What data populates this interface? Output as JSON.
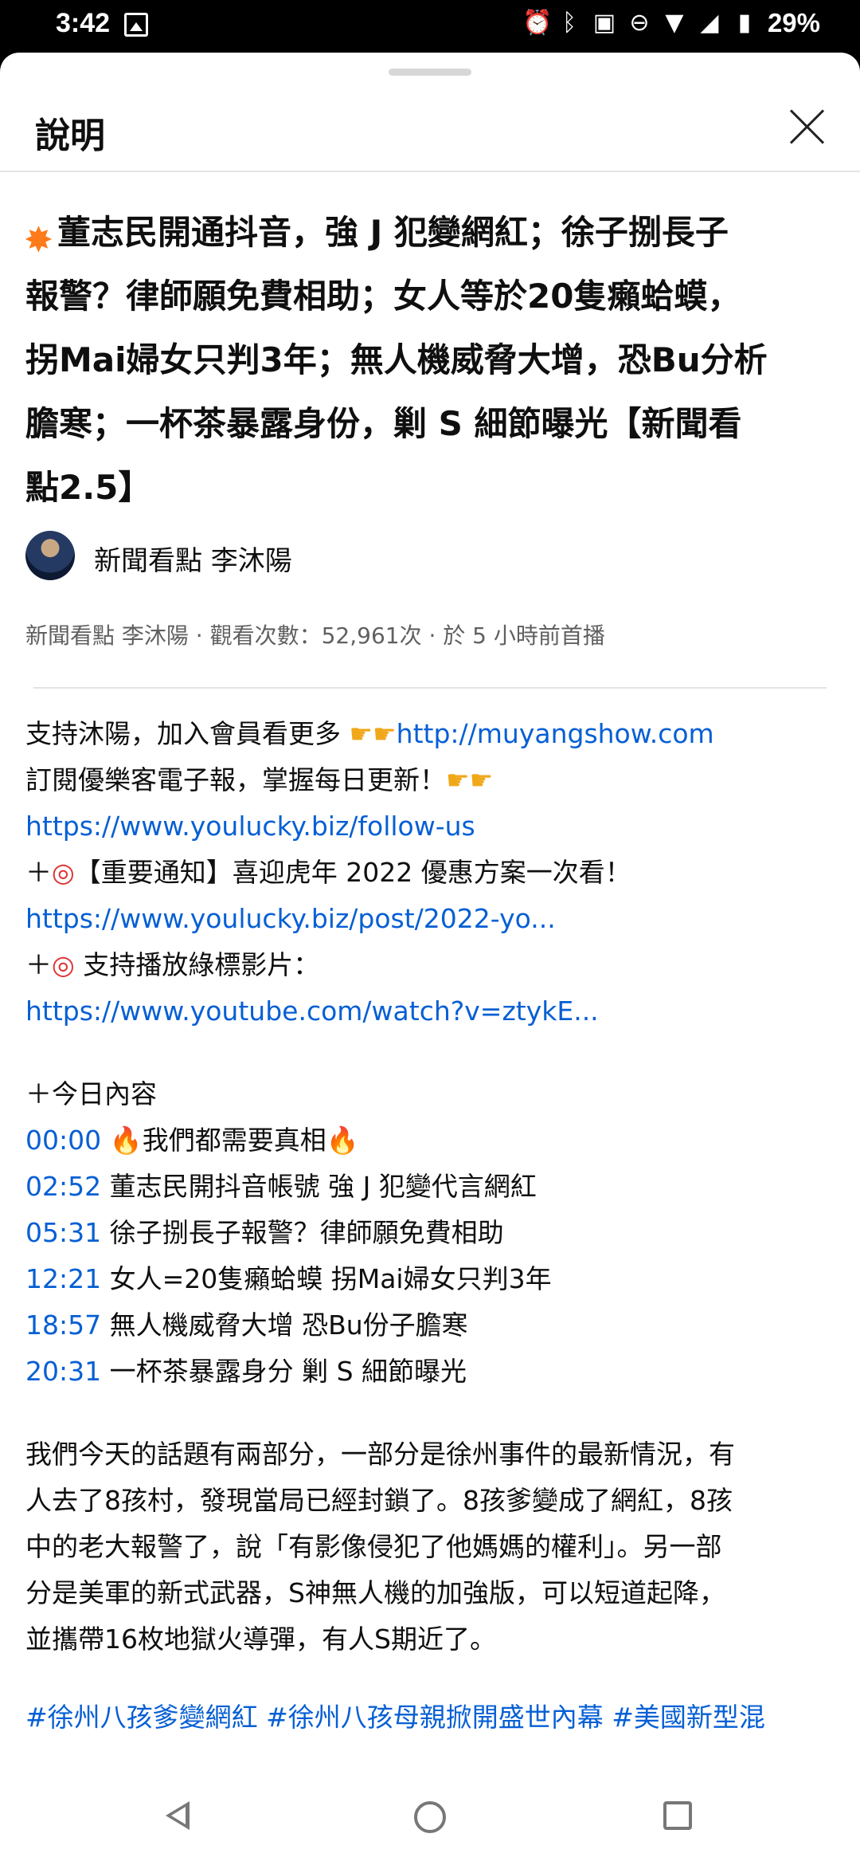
{
  "status_bar": {
    "time": "3:42",
    "battery_percent": "29%",
    "icons": [
      "image-notification-icon",
      "alarm-icon",
      "bluetooth-icon",
      "nfc-icon",
      "do-not-disturb-icon",
      "wifi-icon",
      "signal-icon",
      "battery-icon"
    ]
  },
  "sheet": {
    "title": "說明",
    "close_label": "close"
  },
  "video": {
    "title_lines": [
      "董志民開通抖音，強 J 犯變網紅；徐子捌長子",
      "報警？律師願免費相助；女人等於20隻癩蛤蟆，",
      "拐Mai婦女只判3年；無人機威脅大增，恐Bu分析",
      "膽寒；一杯茶暴露身份，剿 S 細節曝光【新聞看",
      "點2.5】"
    ],
    "channel_name": "新聞看點 李沐陽",
    "meta": "新聞看點 李沐陽 · 觀看次數：52,961次 · 於 5 小時前首播"
  },
  "description": {
    "line1_text": "支持沐陽，加入會員看更多 ",
    "line1_link": "http://muyangshow.com",
    "line2_text": "訂閱優樂客電子報，掌握每日更新！",
    "line3_link": "https://www.youlucky.biz/follow-us",
    "line4_text": "【重要通知】喜迎虎年 2022 優惠方案一次看！",
    "line5_link": "https://www.youlucky.biz/post/2022-yo...",
    "line6_text": " 支持播放綠標影片：",
    "line7_link": "https://www.youtube.com/watch?v=ztykE...",
    "plus": "＋",
    "today_header": "今日內容",
    "timestamps": [
      {
        "time": "00:00",
        "text": "我們都需要真相",
        "fire": true
      },
      {
        "time": "02:52",
        "text": " 董志民開抖音帳號  強 J 犯變代言網紅",
        "fire": false
      },
      {
        "time": "05:31",
        "text": " 徐子捌長子報警？律師願免費相助",
        "fire": false
      },
      {
        "time": "12:21",
        "text": " 女人=20隻癩蛤蟆  拐Mai婦女只判3年",
        "fire": false
      },
      {
        "time": "18:57",
        "text": " 無人機威脅大增  恐Bu份子膽寒",
        "fire": false
      },
      {
        "time": "20:31",
        "text": " 一杯茶暴露身分 剿 S 細節曝光",
        "fire": false
      }
    ],
    "summary_lines": [
      "我們今天的話題有兩部分，一部分是徐州事件的最新情況，有",
      "人去了8孩村，發現當局已經封鎖了。8孩爹變成了網紅，8孩",
      "中的老大報警了，說「有影像侵犯了他媽媽的權利」。另一部",
      "分是美軍的新式武器，S神無人機的加強版，可以短道起降，",
      "並攜帶16枚地獄火導彈，有人S期近了。"
    ],
    "hashtags": "#徐州八孩爹變網紅 #徐州八孩母親掀開盛世內幕 #美國新型混"
  },
  "colors": {
    "link": "#065fd4",
    "meta_text": "#606060",
    "text": "#0f0f0f"
  }
}
